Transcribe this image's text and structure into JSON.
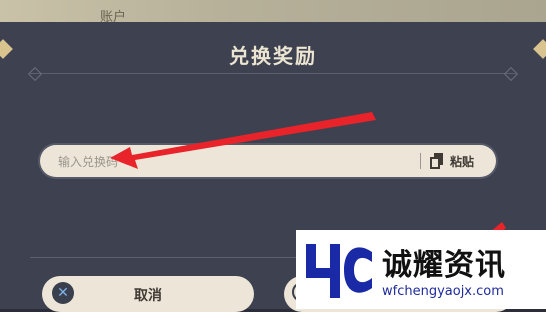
{
  "backdrop": {
    "label": "账户"
  },
  "dialog": {
    "title": "兑换奖励",
    "code_input": {
      "placeholder": "输入兑换码",
      "value": ""
    },
    "paste_label": "粘贴",
    "cancel_label": "取消"
  },
  "watermark": {
    "title": "诚耀资讯",
    "url": "wfchengyaojx.com"
  },
  "colors": {
    "panel": "#3d4150",
    "field": "#ece5d8",
    "accent_gold": "#d9c48f",
    "arrow": "#e8232a",
    "watermark_blue": "#1a2aa6"
  },
  "icons": [
    "paste-icon",
    "cancel-icon",
    "confirm-icon"
  ]
}
